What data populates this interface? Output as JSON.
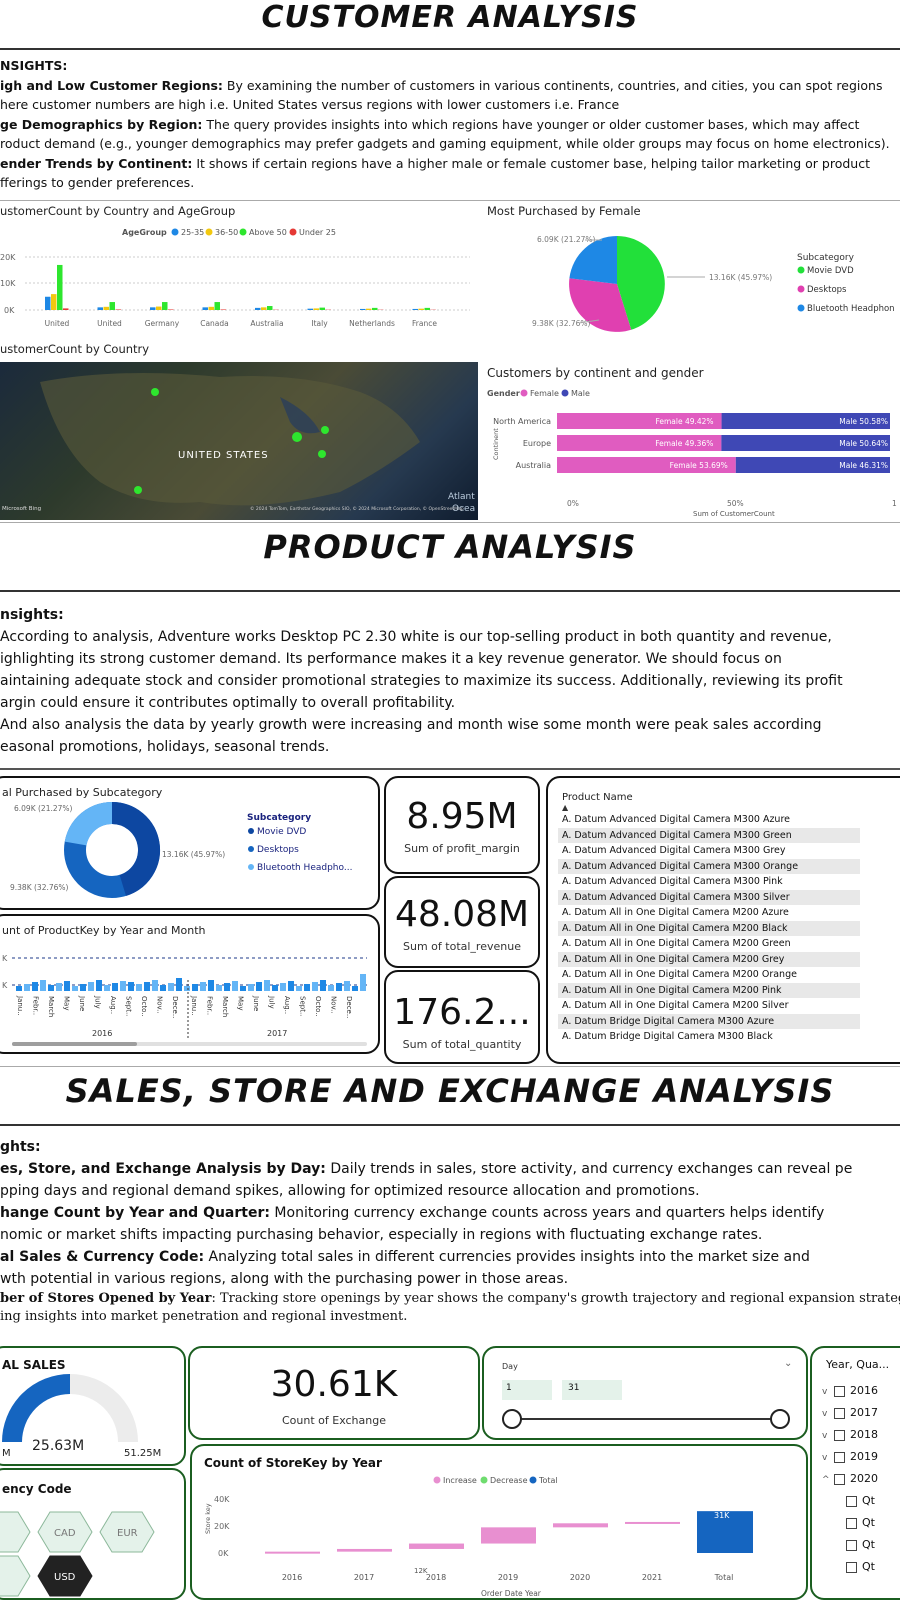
{
  "customer": {
    "title": "CUSTOMER ANALYSIS",
    "insights_heading": "NSIGHTS:",
    "insights": [
      {
        "bold": "igh and Low Customer Regions:",
        "text": " By examining the number of customers in various continents, countries, and cities, you can spot regions"
      },
      {
        "bold": "",
        "text": "here customer numbers are high i.e. United States versus regions with lower customers i.e. France"
      },
      {
        "bold": "ge Demographics by Region:",
        "text": " The query provides insights into which regions have younger or older customer bases, which may affect"
      },
      {
        "bold": "",
        "text": "roduct demand (e.g., younger demographics may prefer gadgets and gaming equipment, while older groups may focus on home electronics)."
      },
      {
        "bold": "ender Trends by Continent:",
        "text": " It shows if certain regions have a higher male or female customer base, helping tailor marketing or product"
      },
      {
        "bold": "",
        "text": "fferings to gender preferences."
      }
    ],
    "age_chart": {
      "title": "ustomerCount by Country and AgeGroup",
      "legend_title": "AgeGroup",
      "legend": [
        "25-35",
        "36-50",
        "Above 50",
        "Under 25"
      ],
      "colors": [
        "#1e88e5",
        "#f2c80f",
        "#2ee62e",
        "#e53935"
      ],
      "y_ticks": [
        "20K",
        "10K",
        "0K"
      ],
      "categories": [
        "United",
        "United",
        "Germany",
        "Canada",
        "Australia",
        "Italy",
        "Netherlands",
        "France"
      ]
    },
    "female_pie": {
      "title": "Most Purchased by Female",
      "labels": [
        "6.09K (21.27%)",
        "13.16K (45.97%)",
        "9.38K (32.76%)"
      ],
      "legend_title": "Subcategory",
      "legend": [
        "Movie DVD",
        "Desktops",
        "Bluetooth Headphon"
      ],
      "colors": [
        "#22e03a",
        "#e040b0",
        "#1e88e5"
      ]
    },
    "map": {
      "title": "ustomerCount by Country",
      "label": "UNITED STATES",
      "ocean": "Atlant",
      "ocean2": "Ocea",
      "brand": "Microsoft Bing",
      "credit": "© 2024 TomTom, Earthstar Geographics SIO, © 2024 Microsoft Corporation, © OpenStreetMap"
    },
    "gender_chart": {
      "title": "Customers by continent and gender",
      "legend_title": "Gender",
      "legend": [
        "Female",
        "Male"
      ],
      "colors": [
        "#e05cc0",
        "#3f48b5"
      ],
      "axis_label": "Continent",
      "xlabel": "Sum of CustomerCount",
      "x_ticks": [
        "0%",
        "50%",
        "1"
      ],
      "rows": [
        {
          "name": "North America",
          "female": "Female 49.42%",
          "male": "Male 50.58%"
        },
        {
          "name": "Europe",
          "female": "Female 49.36%",
          "male": "Male 50.64%"
        },
        {
          "name": "Australia",
          "female": "Female 53.69%",
          "male": "Male 46.31%"
        }
      ]
    }
  },
  "product": {
    "title": "PRODUCT ANALYSIS",
    "insights_heading": "nsights:",
    "insights": [
      "According to analysis, Adventure works Desktop PC 2.30 white is our top-selling product in both quantity and revenue,",
      "ighlighting its strong customer demand. Its performance makes it a key revenue generator. We should focus on",
      "aintaining adequate stock and consider promotional strategies to maximize its success. Additionally, reviewing its profit",
      "argin could ensure it contributes optimally to overall profitability.",
      "And also analysis the data by yearly growth were increasing and month wise some month were peak sales according",
      "easonal promotions, holidays, seasonal trends."
    ],
    "donut": {
      "title": "al Purchased by Subcategory",
      "labels": [
        "6.09K (21.27%)",
        "13.16K (45.97%)",
        "9.38K (32.76%)"
      ],
      "legend_title": "Subcategory",
      "legend": [
        "Movie DVD",
        "Desktops",
        "Bluetooth Headpho..."
      ],
      "colors": [
        "#0d47a1",
        "#1565c0",
        "#64b5f6"
      ]
    },
    "monthly": {
      "title": "unt of ProductKey by Year and Month",
      "y_ticks": [
        "K",
        "K"
      ],
      "months": [
        "Janu..",
        "Febr..",
        "March",
        "May",
        "June",
        "July",
        "Aug..",
        "Sept..",
        "Octo..",
        "Nov..",
        "Dece.."
      ],
      "years": [
        "2016",
        "2017"
      ]
    },
    "kpis": [
      {
        "value": "8.95M",
        "label": "Sum of profit_margin"
      },
      {
        "value": "48.08M",
        "label": "Sum of total_revenue"
      },
      {
        "value": "176.2...",
        "label": "Sum of total_quantity"
      }
    ],
    "table": {
      "header": "Product Name",
      "rows": [
        "A. Datum Advanced Digital Camera M300 Azure",
        "A. Datum Advanced Digital Camera M300 Green",
        "A. Datum Advanced Digital Camera M300 Grey",
        "A. Datum Advanced Digital Camera M300 Orange",
        "A. Datum Advanced Digital Camera M300 Pink",
        "A. Datum Advanced Digital Camera M300 Silver",
        "A. Datum All in One Digital Camera M200 Azure",
        "A. Datum All in One Digital Camera M200 Black",
        "A. Datum All in One Digital Camera M200 Green",
        "A. Datum All in One Digital Camera M200 Grey",
        "A. Datum All in One Digital Camera M200 Orange",
        "A. Datum All in One Digital Camera M200 Pink",
        "A. Datum All in One Digital Camera M200 Silver",
        "A. Datum Bridge Digital Camera M300 Azure",
        "A. Datum Bridge Digital Camera M300 Black"
      ]
    }
  },
  "sales": {
    "title": "SALES, STORE AND EXCHANGE ANALYSIS",
    "insights_heading": "ghts:",
    "insights": [
      {
        "bold": "es, Store, and Exchange Analysis by Day:",
        "text": " Daily trends in sales, store activity, and currency exchanges can reveal pe"
      },
      {
        "bold": "",
        "text": "pping days and regional demand spikes, allowing for optimized resource allocation and promotions."
      },
      {
        "bold": "hange Count by Year and Quarter:",
        "text": " Monitoring currency exchange counts across years and quarters helps identify"
      },
      {
        "bold": "",
        "text": "nomic or market shifts impacting purchasing behavior, especially in regions with fluctuating exchange rates."
      },
      {
        "bold": "al Sales & Currency Code:",
        "text": " Analyzing total sales in different currencies provides insights into the market size and"
      },
      {
        "bold": "",
        "text": "wth potential in various regions, along with the purchasing power in those areas."
      },
      {
        "bold": "ber of Stores Opened by Year",
        "text": ": Tracking store openings by year shows the company's growth trajectory and regional expansion strategi"
      },
      {
        "bold": "",
        "text": "ing insights into market penetration and regional investment."
      }
    ],
    "gauge": {
      "title": "AL SALES",
      "value": "25.63M",
      "max": "51.25M",
      "min": "M",
      "fraction": 0.5
    },
    "exchange": {
      "value": "30.61K",
      "label": "Count of Exchange"
    },
    "slicer": {
      "title": "Day",
      "from": "1",
      "to": "31"
    },
    "currency": {
      "title": "ency Code",
      "codes": [
        "CAD",
        "EUR",
        "USD"
      ]
    },
    "storekey": {
      "title": "Count of StoreKey by Year",
      "legend": [
        "Increase",
        "Decrease",
        "Total"
      ],
      "colors": [
        "#e88fd0",
        "#6fdc6f",
        "#1565c0"
      ],
      "y_ticks": [
        "40K",
        "20K",
        "0K"
      ],
      "ylabel": "Store key",
      "xlabel": "Order Date Year",
      "categories": [
        "2016",
        "2017",
        "2018",
        "2019",
        "2020",
        "2021",
        "Total"
      ],
      "label_2019": "12K",
      "label_total": "31K"
    },
    "year_slicer": {
      "title": "Year, Qua...",
      "years": [
        "2016",
        "2017",
        "2018",
        "2019",
        "2020"
      ],
      "quarters": [
        "Qt",
        "Qt",
        "Qt",
        "Qt"
      ]
    }
  }
}
